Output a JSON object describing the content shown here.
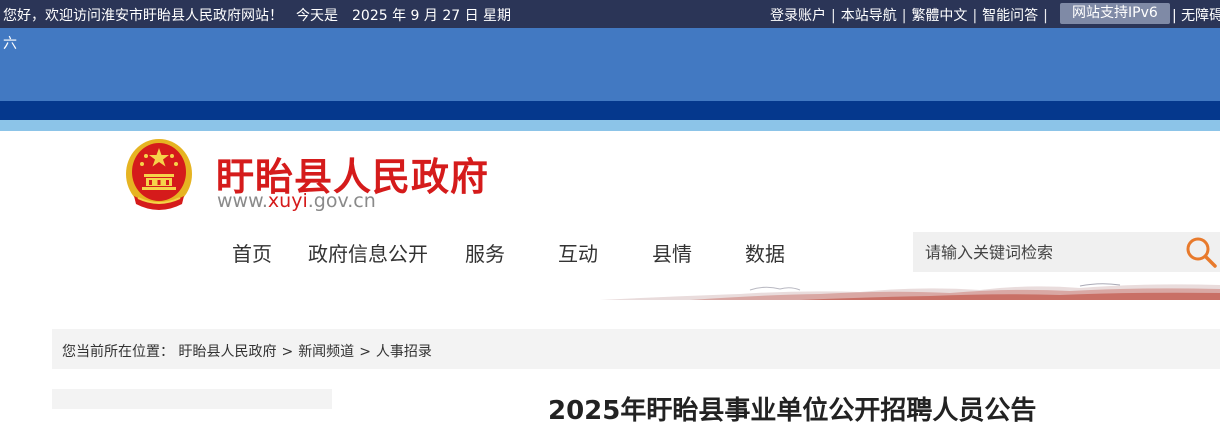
{
  "topbar": {
    "greeting": "您好，欢迎访问淮安市盱眙县人民政府网站！",
    "date_text": "今天是　2025 年 9 月 27 日 星期",
    "weekday_tail": "六",
    "links": [
      "登录账户",
      "本站导航",
      "繁體中文",
      "智能问答"
    ],
    "ipv6_label": "网站支持IPv6",
    "accessibility": "无障碍"
  },
  "header": {
    "site_name": "盱眙县人民政府",
    "url_prefix": "www.",
    "url_accent": "xuyi",
    "url_suffix": ".gov.cn"
  },
  "nav": {
    "items": [
      "首页",
      "政府信息公开",
      "服务",
      "互动",
      "县情",
      "数据"
    ]
  },
  "search": {
    "placeholder": "请输入关键词检索"
  },
  "breadcrumb": {
    "prefix": "您当前所在位置：",
    "items": [
      "盱眙县人民政府",
      "新闻频道",
      "人事招录"
    ]
  },
  "article": {
    "title": "2025年盱眙县事业单位公开招聘人员公告"
  },
  "colors": {
    "topbar": "#2b3557",
    "band": "#4279c2",
    "band_dark": "#05388d",
    "band_light": "#8cc4e8",
    "brand_red": "#d51b1b",
    "search_icon": "#e87a2c"
  }
}
